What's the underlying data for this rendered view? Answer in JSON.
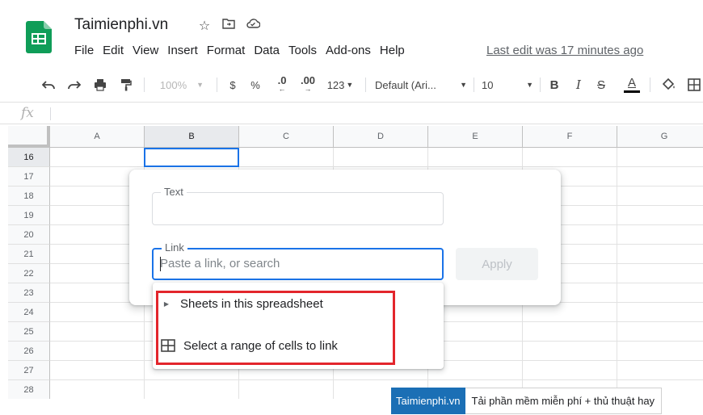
{
  "app": {
    "title": "Taimienphi.vn",
    "last_edit": "Last edit was 17 minutes ago",
    "brand_color": "#0f9d58",
    "accent_color": "#1a73e8"
  },
  "menu": [
    "File",
    "Edit",
    "View",
    "Insert",
    "Format",
    "Data",
    "Tools",
    "Add-ons",
    "Help"
  ],
  "toolbar": {
    "zoom": "100%",
    "currency": "$",
    "percent": "%",
    "dec_decrease": ".0",
    "dec_increase": ".00",
    "format_more": "123",
    "font": "Default (Ari...",
    "font_size": "10",
    "bold": "B",
    "italic": "I",
    "strike": "S",
    "text_color": "A"
  },
  "formula_bar": {
    "fx": "fx"
  },
  "grid": {
    "columns": [
      "A",
      "B",
      "C",
      "D",
      "E",
      "F",
      "G"
    ],
    "selected_column": "B",
    "rows": [
      "16",
      "17",
      "18",
      "19",
      "20",
      "21",
      "22",
      "23",
      "24",
      "25",
      "26",
      "27",
      "28"
    ],
    "selected_row": "16"
  },
  "dialog": {
    "text_label": "Text",
    "text_value": "",
    "link_label": "Link",
    "link_placeholder": "Paste a link, or search",
    "apply_label": "Apply"
  },
  "dropdown": {
    "items": [
      {
        "label": "Sheets in this spreadsheet",
        "icon": "triangle-right-icon"
      },
      {
        "label": "Select a range of cells to link",
        "icon": "grid-icon"
      }
    ]
  },
  "watermark": {
    "brand": "Taimienphi.vn",
    "tagline": "Tải phần mềm miễn phí + thủ thuật hay"
  }
}
